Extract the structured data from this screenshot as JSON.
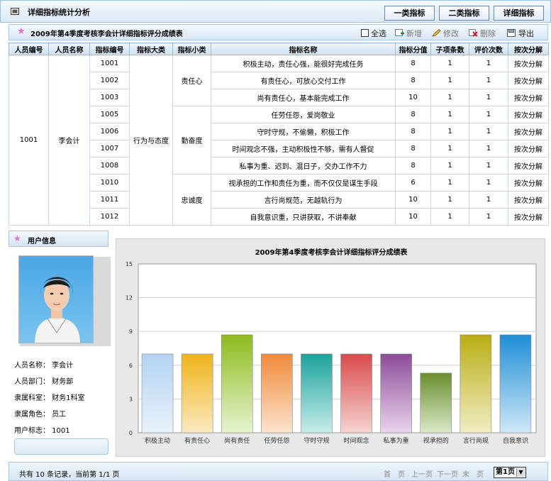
{
  "header": {
    "title": "详细指标统计分析",
    "buttons": [
      "一类指标",
      "二类指标",
      "详细指标"
    ]
  },
  "subbar": {
    "title": "2009年第4季度考核李会计详细指标评分成绩表",
    "select_all": "全选",
    "add": "新增",
    "edit": "修改",
    "delete": "删除",
    "export": "导出"
  },
  "table": {
    "headers": [
      "人员编号",
      "人员名称",
      "指标编号",
      "指标大类",
      "指标小类",
      "指标名称",
      "指标分值",
      "子项条数",
      "评价次数",
      "按次分解"
    ],
    "person_id": "1001",
    "person_name": "李会计",
    "category": "行为与态度",
    "subcategories": [
      "责任心",
      "勤奋度",
      "忠诚度"
    ],
    "rows": [
      {
        "code": "1001",
        "name": "积极主动，责任心强，能很好完成任务",
        "score": "8",
        "items": "1",
        "evals": "1",
        "action": "按次分解"
      },
      {
        "code": "1002",
        "name": "有责任心，可放心交付工作",
        "score": "8",
        "items": "1",
        "evals": "1",
        "action": "按次分解"
      },
      {
        "code": "1003",
        "name": "尚有责任心，基本能完成工作",
        "score": "10",
        "items": "1",
        "evals": "1",
        "action": "按次分解"
      },
      {
        "code": "1005",
        "name": "任劳任怨，爱岗敬业",
        "score": "8",
        "items": "1",
        "evals": "1",
        "action": "按次分解"
      },
      {
        "code": "1006",
        "name": "守时守规，不偷懒，积极工作",
        "score": "8",
        "items": "1",
        "evals": "1",
        "action": "按次分解"
      },
      {
        "code": "1007",
        "name": "时间观念不强，主动积极性不够，需有人督促",
        "score": "8",
        "items": "1",
        "evals": "1",
        "action": "按次分解"
      },
      {
        "code": "1008",
        "name": "私事为重、迟到、混日子，交办工作不力",
        "score": "8",
        "items": "1",
        "evals": "1",
        "action": "按次分解"
      },
      {
        "code": "1010",
        "name": "视承担的工作和责任为重，而不仅仅是谋生手段",
        "score": "6",
        "items": "1",
        "evals": "1",
        "action": "按次分解"
      },
      {
        "code": "1011",
        "name": "言行尚规范，无越轨行为",
        "score": "10",
        "items": "1",
        "evals": "1",
        "action": "按次分解"
      },
      {
        "code": "1012",
        "name": "自我意识重，只讲获取，不讲奉献",
        "score": "10",
        "items": "1",
        "evals": "1",
        "action": "按次分解"
      }
    ]
  },
  "user": {
    "panel_title": "用户信息",
    "info": [
      "人员名称： 李会计",
      "人员部门： 财务部",
      "隶属科室： 财务1科室",
      "隶属角色： 员工",
      "用户标志： 1001"
    ]
  },
  "chart_data": {
    "type": "bar",
    "title": "2009年第4季度考核李会计详细指标评分成绩表",
    "categories": [
      "积极主动",
      "有责任心",
      "尚有责任",
      "任劳任怨",
      "守时守规",
      "时间观念",
      "私事为重",
      "视承担的",
      "言行尚规",
      "自我意识"
    ],
    "values": [
      7,
      7,
      8.7,
      7,
      7,
      7,
      7,
      5.3,
      8.7,
      8.7
    ],
    "ylim": [
      0,
      15
    ],
    "yticks": [
      0,
      3,
      6,
      9,
      12,
      15
    ],
    "grid": true,
    "colors": [
      [
        "#b3d3f1",
        "#e9f2fb"
      ],
      [
        "#efb31a",
        "#fbe9c0"
      ],
      [
        "#8dbb1d",
        "#e8f3cf"
      ],
      [
        "#f08a3a",
        "#fde3cd"
      ],
      [
        "#1aa39c",
        "#c9ecea"
      ],
      [
        "#d94a4a",
        "#f7d3d3"
      ],
      [
        "#8d4b9a",
        "#e8d5ec"
      ],
      [
        "#6a8e2f",
        "#dbe8c8"
      ],
      [
        "#b9ad14",
        "#f1edc2"
      ],
      [
        "#1f8fd6",
        "#cfe7f7"
      ]
    ]
  },
  "footer": {
    "summary": "共有 10 条记录，当前第 1/1 页",
    "first": "首　页",
    "prev": "上一页",
    "next": "下一页",
    "last": "末　页",
    "page_select": "第1页"
  }
}
